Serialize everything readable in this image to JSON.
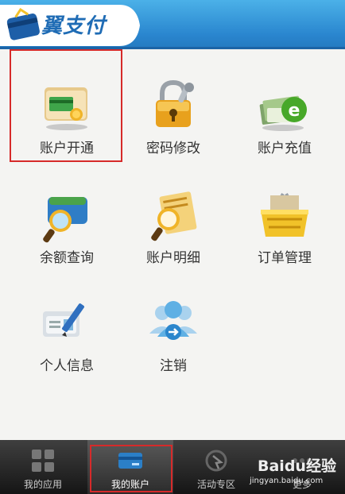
{
  "header": {
    "logo_text": "翼支付"
  },
  "tiles": [
    {
      "label": "账户开通",
      "icon": "wallet-card-icon"
    },
    {
      "label": "密码修改",
      "icon": "padlock-key-icon"
    },
    {
      "label": "账户充值",
      "icon": "money-e-icon"
    },
    {
      "label": "余额查询",
      "icon": "wallet-magnifier-icon"
    },
    {
      "label": "账户明细",
      "icon": "document-magnifier-icon"
    },
    {
      "label": "订单管理",
      "icon": "shopping-basket-icon"
    },
    {
      "label": "个人信息",
      "icon": "id-card-pen-icon"
    },
    {
      "label": "注销",
      "icon": "users-logout-icon"
    }
  ],
  "nav": {
    "items": [
      {
        "label": "我的应用",
        "icon": "apps-grid-icon",
        "active": false
      },
      {
        "label": "我的账户",
        "icon": "card-icon",
        "active": true
      },
      {
        "label": "活动专区",
        "icon": "gift-icon",
        "active": false
      },
      {
        "label": "更多",
        "icon": "more-icon",
        "active": false
      }
    ]
  },
  "watermark": {
    "brand": "Baidu经验",
    "url": "jingyan.baidu.com"
  },
  "colors": {
    "header_blue": "#2a86cf",
    "highlight_red": "#d62a2a"
  }
}
